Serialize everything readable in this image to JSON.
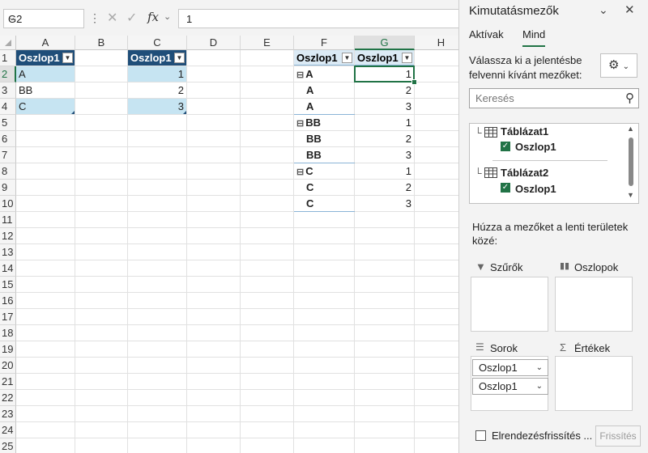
{
  "formula_bar": {
    "name_box": "G2",
    "formula": "1",
    "fx_label": "fx"
  },
  "sheet": {
    "columns": [
      "A",
      "B",
      "C",
      "D",
      "E",
      "F",
      "G",
      "H"
    ],
    "rows": [
      "1",
      "2",
      "3",
      "4",
      "5",
      "6",
      "7",
      "8",
      "9",
      "10",
      "11",
      "12",
      "13",
      "14",
      "15",
      "16",
      "17",
      "18",
      "19",
      "20",
      "21",
      "22",
      "23",
      "24",
      "25"
    ],
    "selected_column": "G",
    "selected_row": "2"
  },
  "table1": {
    "header": "Oszlop1",
    "values": [
      "A",
      "BB",
      "C"
    ]
  },
  "table2": {
    "header": "Oszlop1",
    "values": [
      "1",
      "2",
      "3"
    ]
  },
  "pivot": {
    "row_header": "Oszlop1",
    "value_header": "Oszlop1",
    "groups": [
      {
        "label": "A",
        "rows": [
          {
            "label": "A",
            "value": "1"
          },
          {
            "label": "A",
            "value": "2"
          },
          {
            "label": "A",
            "value": "3"
          }
        ]
      },
      {
        "label": "BB",
        "rows": [
          {
            "label": "BB",
            "value": "1"
          },
          {
            "label": "BB",
            "value": "2"
          },
          {
            "label": "BB",
            "value": "3"
          }
        ]
      },
      {
        "label": "C",
        "rows": [
          {
            "label": "C",
            "value": "1"
          },
          {
            "label": "C",
            "value": "2"
          },
          {
            "label": "C",
            "value": "3"
          }
        ]
      }
    ]
  },
  "panel": {
    "title": "Kimutatásmezők",
    "tab_active": "Aktívak",
    "tab_all": "Mind",
    "description": "Válassza ki a jelentésbe felvenni kívánt mezőket:",
    "search_placeholder": "Keresés",
    "tables": [
      {
        "name": "Táblázat1",
        "field": "Oszlop1"
      },
      {
        "name": "Táblázat2",
        "field": "Oszlop1"
      }
    ],
    "drag_hint": "Húzza a mezőket a lenti területek közé:",
    "areas": {
      "filters": "Szűrők",
      "columns": "Oszlopok",
      "rows": "Sorok",
      "values": "Értékek"
    },
    "row_fields": [
      "Oszlop1",
      "Oszlop1"
    ],
    "defer_label": "Elrendezésfrissítés ...",
    "update_button": "Frissítés"
  }
}
